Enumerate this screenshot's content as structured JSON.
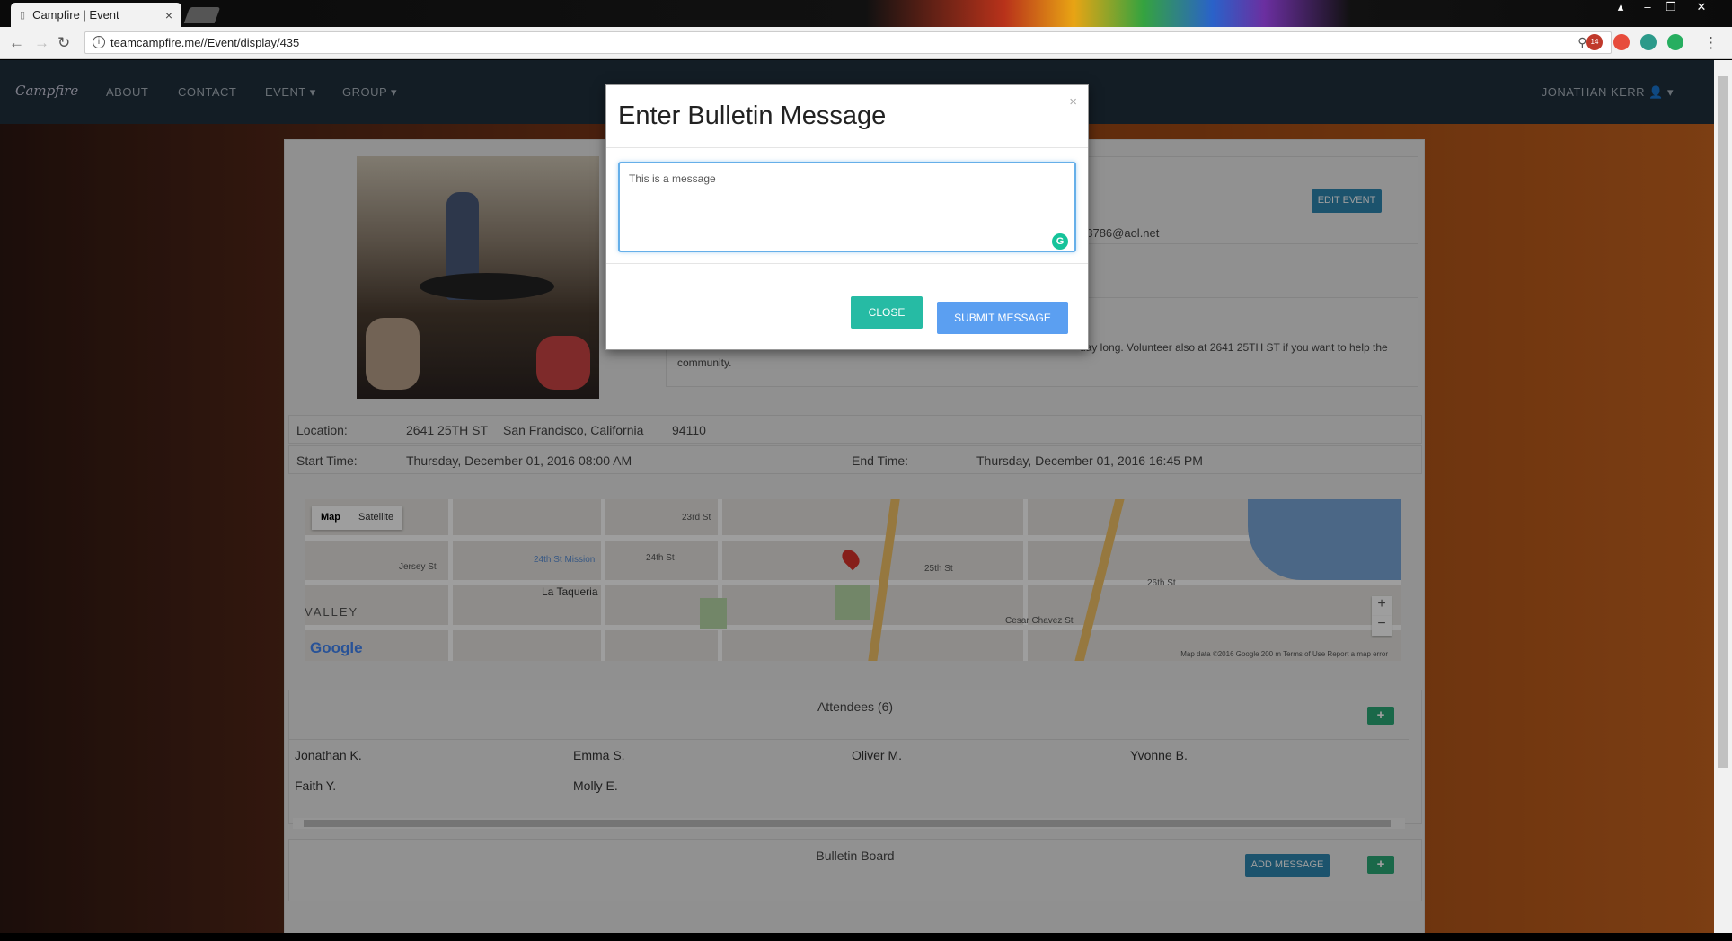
{
  "browser": {
    "tab_title": "Campfire | Event",
    "tab_close": "×",
    "url": "teamcampfire.me//Event/display/435",
    "ext_badge": "14"
  },
  "navbar": {
    "brand": "Campfire",
    "items": [
      "ABOUT",
      "CONTACT",
      "EVENT",
      "GROUP"
    ],
    "user": "JONATHAN KERR"
  },
  "event": {
    "edit_button": "EDIT EVENT",
    "email_fragment": "03786@aol.net",
    "description_fragment": "day long. Volunteer also at 2641 25TH ST if you want to help the",
    "description_line2": "community.",
    "location_label": "Location:",
    "address": "2641 25TH ST",
    "city_state": "San Francisco, California",
    "zip": "94110",
    "start_label": "Start Time:",
    "start_time": "Thursday, December 01, 2016 08:00 AM",
    "end_label": "End Time:",
    "end_time": "Thursday, December 01, 2016 16:45 PM"
  },
  "map": {
    "type_map": "Map",
    "type_satellite": "Satellite",
    "labels": [
      "24th St Mission",
      "La Taqueria",
      "VALLEY",
      "24th St",
      "25th St",
      "26th St",
      "Cesar Chavez St",
      "23rd St",
      "Jersey St"
    ],
    "google": "Google",
    "footer": "Map data ©2016 Google   200 m       Terms of Use   Report a map error",
    "zoom_in": "+",
    "zoom_out": "−"
  },
  "attendees": {
    "title": "Attendees (6)",
    "rows": [
      [
        "Jonathan K.",
        "Emma S.",
        "Oliver M.",
        "Yvonne B."
      ],
      [
        "Faith Y.",
        "Molly E.",
        "",
        ""
      ]
    ]
  },
  "bulletin": {
    "title": "Bulletin Board",
    "add_button": "ADD MESSAGE"
  },
  "modal": {
    "title": "Enter Bulletin Message",
    "close_x": "×",
    "message_value": "This is a message",
    "close_button": "CLOSE",
    "submit_button": "SUBMIT MESSAGE"
  },
  "colors": {
    "accent_green": "#2aa877",
    "accent_blue": "#2e86b0",
    "submit_blue": "#5b9ff1",
    "close_teal": "#26bba4"
  }
}
